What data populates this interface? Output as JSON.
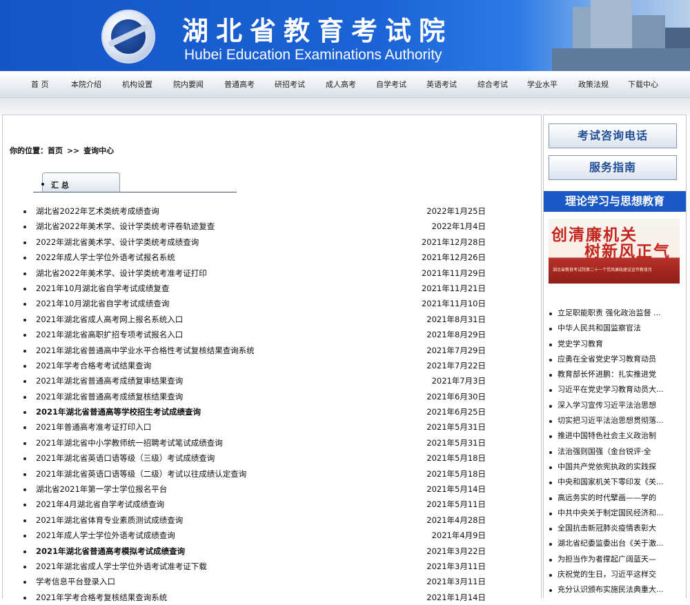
{
  "header": {
    "title_cn": "湖北省教育考试院",
    "title_en": "Hubei Education Examinations Authority",
    "logo_icon": "hubei-eea-emblem-icon"
  },
  "nav": {
    "items": [
      {
        "label": "首  页"
      },
      {
        "label": "本院介绍"
      },
      {
        "label": "机构设置"
      },
      {
        "label": "院内要闻"
      },
      {
        "label": "普通高考"
      },
      {
        "label": "研招考试"
      },
      {
        "label": "成人高考"
      },
      {
        "label": "自学考试"
      },
      {
        "label": "英语考试"
      },
      {
        "label": "综合考试"
      },
      {
        "label": "学业水平"
      },
      {
        "label": "政策法规"
      },
      {
        "label": "下载中心"
      }
    ]
  },
  "breadcrumb": {
    "prefix": "你的位置：",
    "home": "首页",
    "sep": ">>",
    "current": "查询中心"
  },
  "tab": {
    "label": "汇 总"
  },
  "results": [
    {
      "title": "湖北省2022年艺术类统考成绩查询",
      "date": "2022年1月25日",
      "bold": false
    },
    {
      "title": "湖北省2022年美术学、设计学类统考评卷轨迹复查",
      "date": "2022年1月4日",
      "bold": false
    },
    {
      "title": "2022年湖北省美术学、设计学类统考成绩查询",
      "date": "2021年12月28日",
      "bold": false
    },
    {
      "title": "2022年成人学士学位外语考试报名系统",
      "date": "2021年12月26日",
      "bold": false
    },
    {
      "title": "湖北省2022年美术学、设计学类统考准考证打印",
      "date": "2021年11月29日",
      "bold": false
    },
    {
      "title": "2021年10月湖北省自学考试成绩复查",
      "date": "2021年11月21日",
      "bold": false
    },
    {
      "title": "2021年10月湖北省自学考试成绩查询",
      "date": "2021年11月10日",
      "bold": false
    },
    {
      "title": "2021年湖北省成人高考网上报名系统入口",
      "date": "2021年8月31日",
      "bold": false
    },
    {
      "title": "2021年湖北省高职扩招专项考试报名入口",
      "date": "2021年8月29日",
      "bold": false
    },
    {
      "title": "2021年湖北省普通高中学业水平合格性考试复核结果查询系统",
      "date": "2021年7月29日",
      "bold": false
    },
    {
      "title": "2021年学考合格考考试结果查询",
      "date": "2021年7月22日",
      "bold": false
    },
    {
      "title": "2021年湖北省普通高考成绩复审结果查询",
      "date": "2021年7月3日",
      "bold": false
    },
    {
      "title": "2021年湖北省普通高考成绩复核结果查询",
      "date": "2021年6月30日",
      "bold": false
    },
    {
      "title": "2021年湖北省普通高等学校招生考试成绩查询",
      "date": "2021年6月25日",
      "bold": true
    },
    {
      "title": "2021年普通高考准考证打印入口",
      "date": "2021年5月31日",
      "bold": false
    },
    {
      "title": "2021年湖北省中小学教师统一招聘考试笔试成绩查询",
      "date": "2021年5月31日",
      "bold": false
    },
    {
      "title": "2021年湖北省英语口语等级（三级）考试成绩查询",
      "date": "2021年5月18日",
      "bold": false
    },
    {
      "title": "2021年湖北省英语口语等级（二级）考试以往成绩认定查询",
      "date": "2021年5月18日",
      "bold": false
    },
    {
      "title": "湖北省2021年第一学士学位报名平台",
      "date": "2021年5月14日",
      "bold": false
    },
    {
      "title": "2021年4月湖北省自学考试成绩查询",
      "date": "2021年5月11日",
      "bold": false
    },
    {
      "title": "2021年湖北省体育专业素质测试成绩查询",
      "date": "2021年4月28日",
      "bold": false
    },
    {
      "title": "2021年成人学士学位外语考试成绩查询",
      "date": "2021年4月9日",
      "bold": false
    },
    {
      "title": "2021年湖北省普通高考模拟考试成绩查询",
      "date": "2021年3月22日",
      "bold": true
    },
    {
      "title": "2021年湖北省成人学士学位外语考试准考证下载",
      "date": "2021年3月11日",
      "bold": false
    },
    {
      "title": "学考信息平台登录入口",
      "date": "2021年3月11日",
      "bold": false
    },
    {
      "title": "2021年学考合格考复核结果查询系统",
      "date": "2021年1月14日",
      "bold": false
    }
  ],
  "sidebar": {
    "btn_phone": "考试咨询电话",
    "btn_guide": "服务指南",
    "section_title": "理论学习与思想教育",
    "promo_line1": "创清廉机关",
    "promo_line2": "树新风正气",
    "promo_small": "湖北省教育考试院第二十一个党风廉政建设宣传教育月",
    "news": [
      "立足职能职责 强化政治监督 ...",
      "中华人民共和国监察官法",
      "党史学习教育",
      "应勇在全省党史学习教育动员",
      "教育部长怀进鹏：扎实推进党",
      "习近平在党史学习教育动员大...",
      "深入学习宣传习近平法治思想",
      "切实把习近平法治思想贯彻落...",
      "推进中国特色社会主义政治制",
      "法治强则国强（金台锐评·全",
      "中国共产党依宪执政的实践探",
      "中央和国家机关下零印发《关...",
      "高远务实的时代擘画——学的",
      "中共中央关于制定国民经济和...",
      "全国抗击新冠肺炎疫情表彰大",
      "湖北省纪委监委出台《关于激...",
      "为担当作为者撑起广阔蓝天—",
      "庆祝党的生日，习近平这样交",
      "充分认识颁布实施民法典重大..."
    ]
  }
}
